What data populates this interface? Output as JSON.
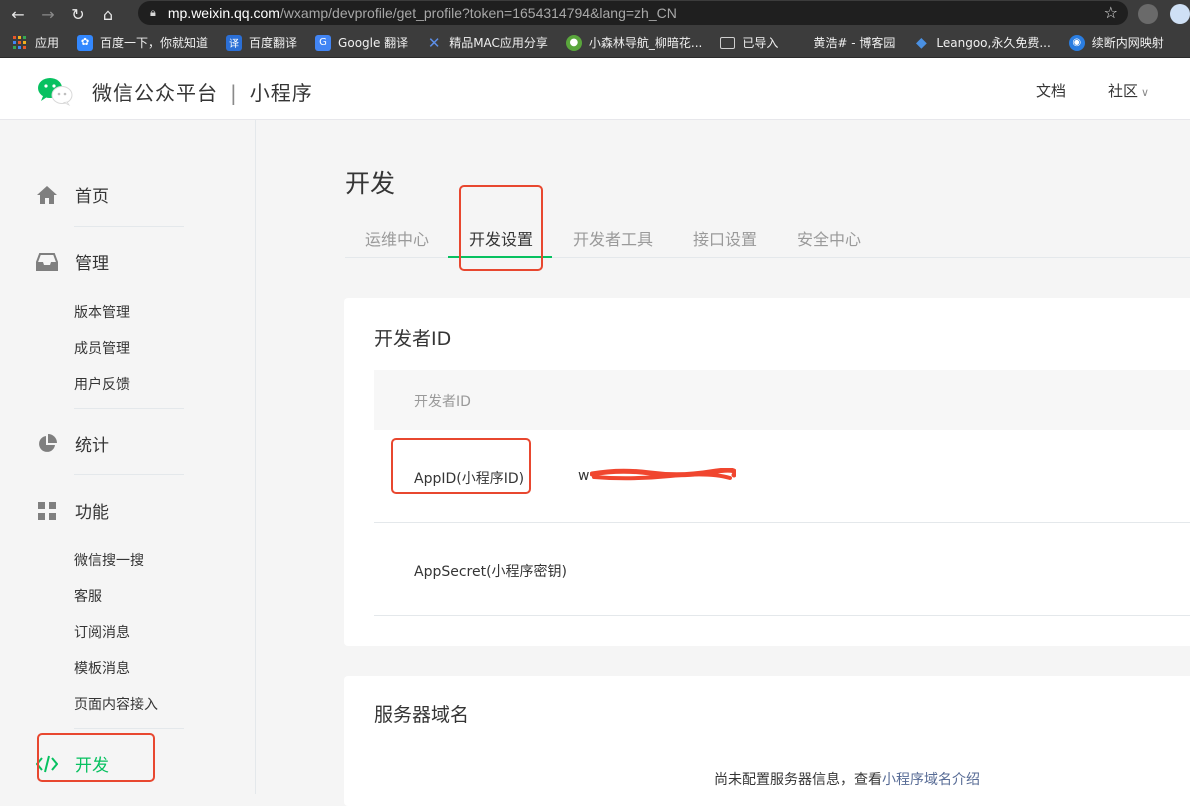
{
  "browser": {
    "url_host": "mp.weixin.qq.com",
    "url_path": "/wxamp/devprofile/get_profile?token=1654314794&lang=zh_CN",
    "bookmarks": [
      {
        "label": "应用",
        "icon": "apps-grid-icon",
        "color": "#e8572a"
      },
      {
        "label": "百度一下，你就知道",
        "icon": "baidu-paw-icon",
        "color": "#3388ff"
      },
      {
        "label": "百度翻译",
        "icon": "baidu-translate-icon",
        "color": "#2b6fd6"
      },
      {
        "label": "Google 翻译",
        "icon": "google-translate-icon",
        "color": "#4285f4"
      },
      {
        "label": "精品MAC应用分享",
        "icon": "x-logo-icon",
        "color": "#3a6fd8"
      },
      {
        "label": "小森林导航_柳暗花...",
        "icon": "turtle-icon",
        "color": "#5aa63c"
      },
      {
        "label": "已导入",
        "icon": "folder-icon",
        "color": "#cfcfcf"
      },
      {
        "label": "黄浩# - 博客园",
        "icon": "",
        "color": "#3c3c3c"
      },
      {
        "label": "Leangoo,永久免费...",
        "icon": "leangoo-icon",
        "color": "#2f7fe0"
      },
      {
        "label": "续断内网映射",
        "icon": "drop-icon",
        "color": "#2a7de1"
      }
    ]
  },
  "header": {
    "brand_main": "微信公众平台",
    "brand_sep": "|",
    "brand_sub": "小程序",
    "doc_link": "文档",
    "community_link": "社区"
  },
  "sidebar": {
    "home": "首页",
    "manage": "管理",
    "manage_items": [
      "版本管理",
      "成员管理",
      "用户反馈"
    ],
    "stats": "统计",
    "features": "功能",
    "feature_items": [
      "微信搜一搜",
      "客服",
      "订阅消息",
      "模板消息",
      "页面内容接入"
    ],
    "develop": "开发"
  },
  "main": {
    "page_title": "开发",
    "tabs": [
      "运维中心",
      "开发设置",
      "开发者工具",
      "接口设置",
      "安全中心"
    ],
    "active_tab": "开发设置",
    "dev_id_card": {
      "title": "开发者ID",
      "table_header": "开发者ID",
      "appid_label": "AppID(小程序ID)",
      "appid_value_prefix": "w",
      "appsecret_label": "AppSecret(小程序密钥)"
    },
    "server_card": {
      "title": "服务器域名",
      "note_prefix": "尚未配置服务器信息，查看",
      "note_link": "小程序域名介绍"
    }
  },
  "colors": {
    "brand_green": "#07c160",
    "highlight_red": "#e8472f",
    "link_blue": "#576b95"
  }
}
